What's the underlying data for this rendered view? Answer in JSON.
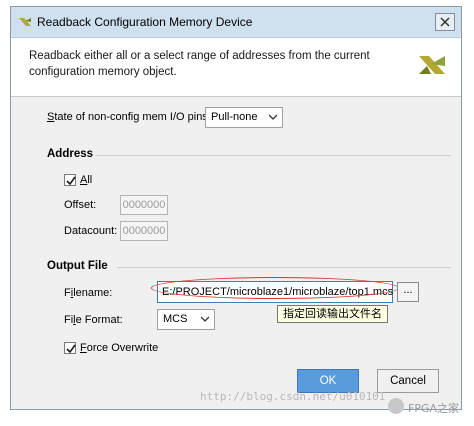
{
  "window": {
    "title": "Readback Configuration Memory Device",
    "close_glyph": "✕"
  },
  "header": {
    "description": "Readback either all or a select range of addresses from the current configuration memory object.",
    "logo_icon": "vivado-logo-icon"
  },
  "state_io": {
    "label_prefix": "",
    "label_underlined": "S",
    "label_rest": "tate of non-config mem I/O pins:",
    "value": "Pull-none"
  },
  "address": {
    "section_title": "Address",
    "all_checked": true,
    "all_label_underlined": "A",
    "all_label_rest": "ll",
    "offset_label": "Offset:",
    "offset_value": "0000000",
    "datacount_label": "Datacount:",
    "datacount_value": "0000000"
  },
  "output_file": {
    "section_title": "Output File",
    "filename_label_pre": "F",
    "filename_label_underlined": "i",
    "filename_label_rest": "lename:",
    "filename_value": "E:/PROJECT/microblaze1/microblaze/top1.mcs",
    "browse_label": "...",
    "tooltip": "指定回读输出文件名",
    "format_label_pre": "Fi",
    "format_label_underlined": "l",
    "format_label_rest": "e Format:",
    "format_value": "MCS",
    "force_checked": true,
    "force_label_underlined": "F",
    "force_label_rest": "orce Overwrite"
  },
  "buttons": {
    "ok": "OK",
    "cancel": "Cancel"
  },
  "watermark": {
    "url_text": "http://blog.csdn.net/u010101",
    "brand_text": "FPGA之家"
  },
  "colors": {
    "ok_button": "#5a9bdc",
    "annotation_ellipse": "#e03030",
    "vivado_logo": "#b4a832"
  }
}
